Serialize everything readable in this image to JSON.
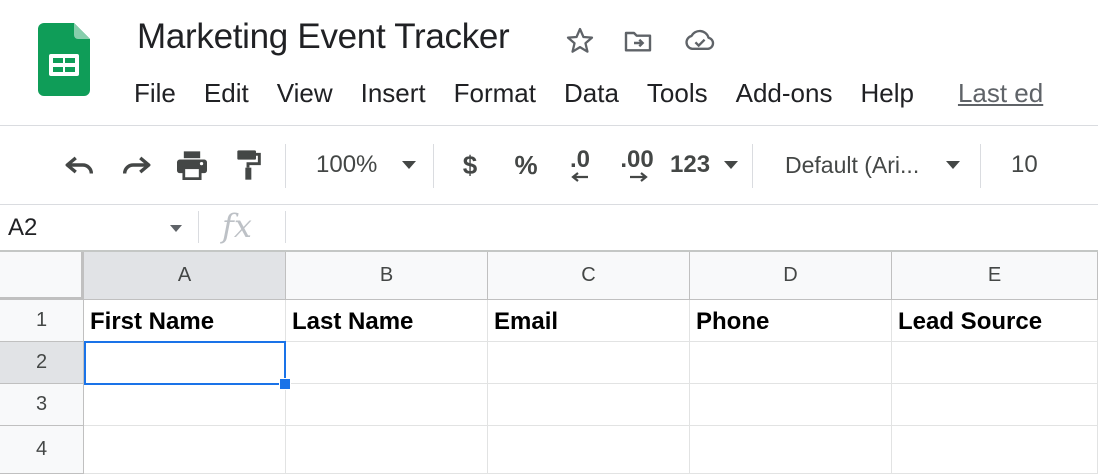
{
  "doc": {
    "title": "Marketing Event Tracker",
    "star_icon": "star-icon",
    "move_icon": "move-to-folder-icon",
    "cloud_icon": "cloud-saved-icon"
  },
  "menu": [
    {
      "label": "File"
    },
    {
      "label": "Edit"
    },
    {
      "label": "View"
    },
    {
      "label": "Insert"
    },
    {
      "label": "Format"
    },
    {
      "label": "Data"
    },
    {
      "label": "Tools"
    },
    {
      "label": "Add-ons"
    },
    {
      "label": "Help"
    },
    {
      "label": "Last ed"
    }
  ],
  "toolbar": {
    "zoom": "100%",
    "currency": "$",
    "percent": "%",
    "decrease_decimal": ".0",
    "increase_decimal": ".00",
    "more_formats": "123",
    "font": "Default (Ari...",
    "font_size": "10"
  },
  "formula_bar": {
    "name_box": "A2",
    "fx": "fx",
    "formula": ""
  },
  "sheet": {
    "columns": [
      "A",
      "B",
      "C",
      "D",
      "E"
    ],
    "rows": [
      "1",
      "2",
      "3",
      "4"
    ],
    "cells": [
      [
        "First Name",
        "Last Name",
        "Email",
        "Phone",
        "Lead Source"
      ],
      [
        "",
        "",
        "",
        "",
        ""
      ],
      [
        "",
        "",
        "",
        "",
        ""
      ],
      [
        "",
        "",
        "",
        "",
        ""
      ]
    ],
    "selected_cell": "A2"
  },
  "colors": {
    "accent": "#1a73e8",
    "logo_green": "#0f9d58"
  }
}
